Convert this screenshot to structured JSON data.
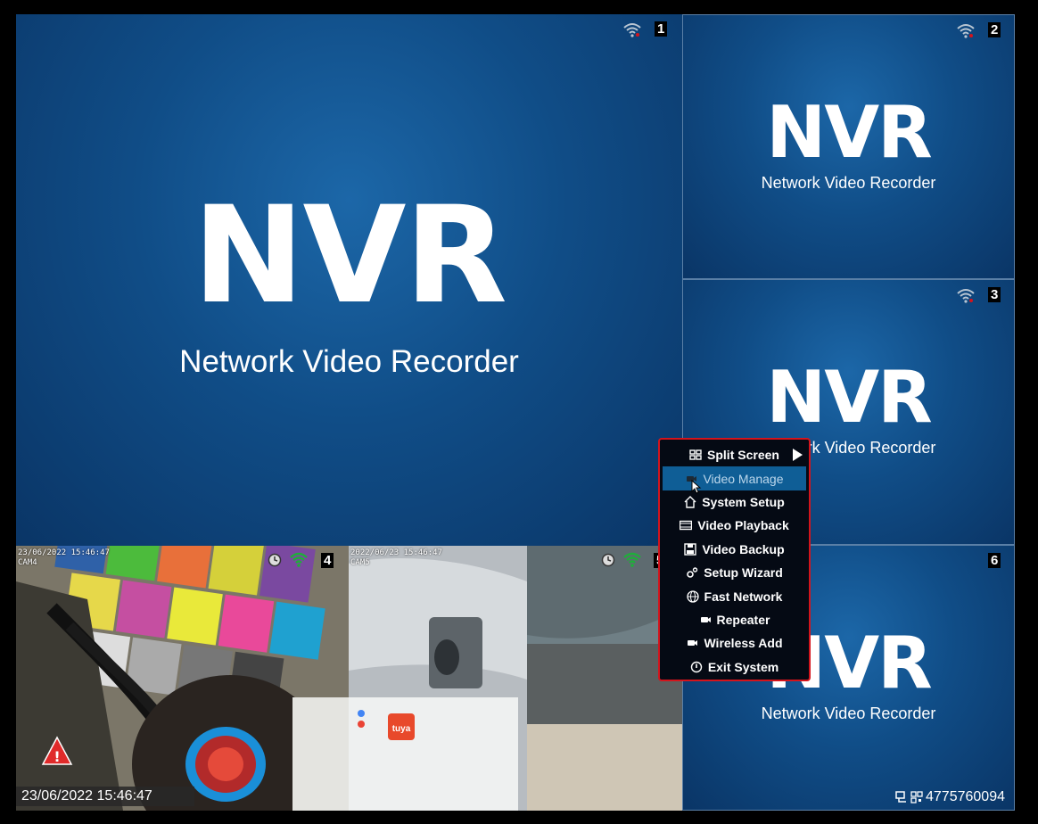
{
  "tiles": [
    {
      "channel": "1",
      "logo": "NVR",
      "subtitle": "Network Video Recorder"
    },
    {
      "channel": "2",
      "logo": "NVR",
      "subtitle": "Network Video Recorder"
    },
    {
      "channel": "3",
      "logo": "NVR",
      "subtitle": "Network Video Recorder"
    },
    {
      "channel": "6",
      "logo": "NVR",
      "subtitle": "Network Video Recorder"
    }
  ],
  "cameras": [
    {
      "channel": "4",
      "osd_time": "23/06/2022 15:46:47",
      "osd_name": "CAM4"
    },
    {
      "channel": "5",
      "osd_time": "2022/06/23 15:46:47",
      "osd_name": "CAM5"
    }
  ],
  "status_bar": {
    "timestamp": "23/06/2022 15:46:47",
    "device_id": "4775760094"
  },
  "context_menu": {
    "items": [
      {
        "label": "Split Screen",
        "icon": "grid-icon",
        "has_submenu": true
      },
      {
        "label": "Video Manage",
        "icon": "camera-icon",
        "active": true
      },
      {
        "label": "System Setup",
        "icon": "home-icon"
      },
      {
        "label": "Video Playback",
        "icon": "film-icon"
      },
      {
        "label": "Video Backup",
        "icon": "floppy-icon"
      },
      {
        "label": "Setup Wizard",
        "icon": "gears-icon"
      },
      {
        "label": "Fast Network",
        "icon": "globe-icon"
      },
      {
        "label": "Repeater",
        "icon": "camera-icon"
      },
      {
        "label": "Wireless Add",
        "icon": "camera-icon"
      },
      {
        "label": "Exit System",
        "icon": "power-icon"
      }
    ]
  },
  "colors": {
    "menu_border": "#d4141c",
    "menu_highlight": "#0f5e96",
    "tile_blue": "#104d87",
    "wifi_active": "#1fae3a"
  }
}
